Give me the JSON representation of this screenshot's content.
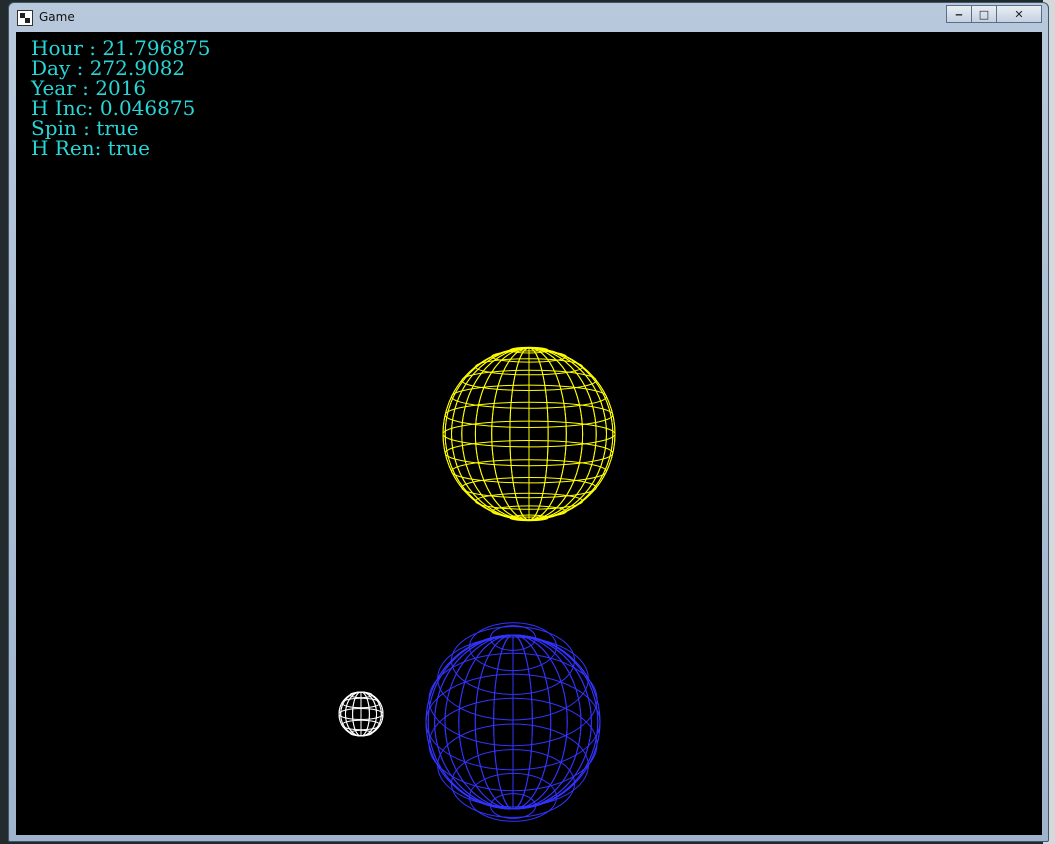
{
  "window": {
    "title": "Game"
  },
  "controls": {
    "minimize": "‒",
    "maximize": "□",
    "close": "✕"
  },
  "hud": {
    "hour": "Hour : 21.796875",
    "day": "Day : 272.9082",
    "year": "Year : 2016",
    "h_inc": "H Inc: 0.046875",
    "spin": "Spin : true",
    "h_ren": "H Ren: true"
  },
  "colors": {
    "sun": "#ffff00",
    "planet": "#3333ff",
    "moon": "#ffffff",
    "hud_text": "#29d6d6",
    "background": "#000000"
  },
  "scene": {
    "bodies": [
      {
        "name": "sun-sphere",
        "color": "#ffff00"
      },
      {
        "name": "planet-sphere",
        "color": "#3333ff"
      },
      {
        "name": "moon-sphere",
        "color": "#ffffff"
      }
    ]
  }
}
